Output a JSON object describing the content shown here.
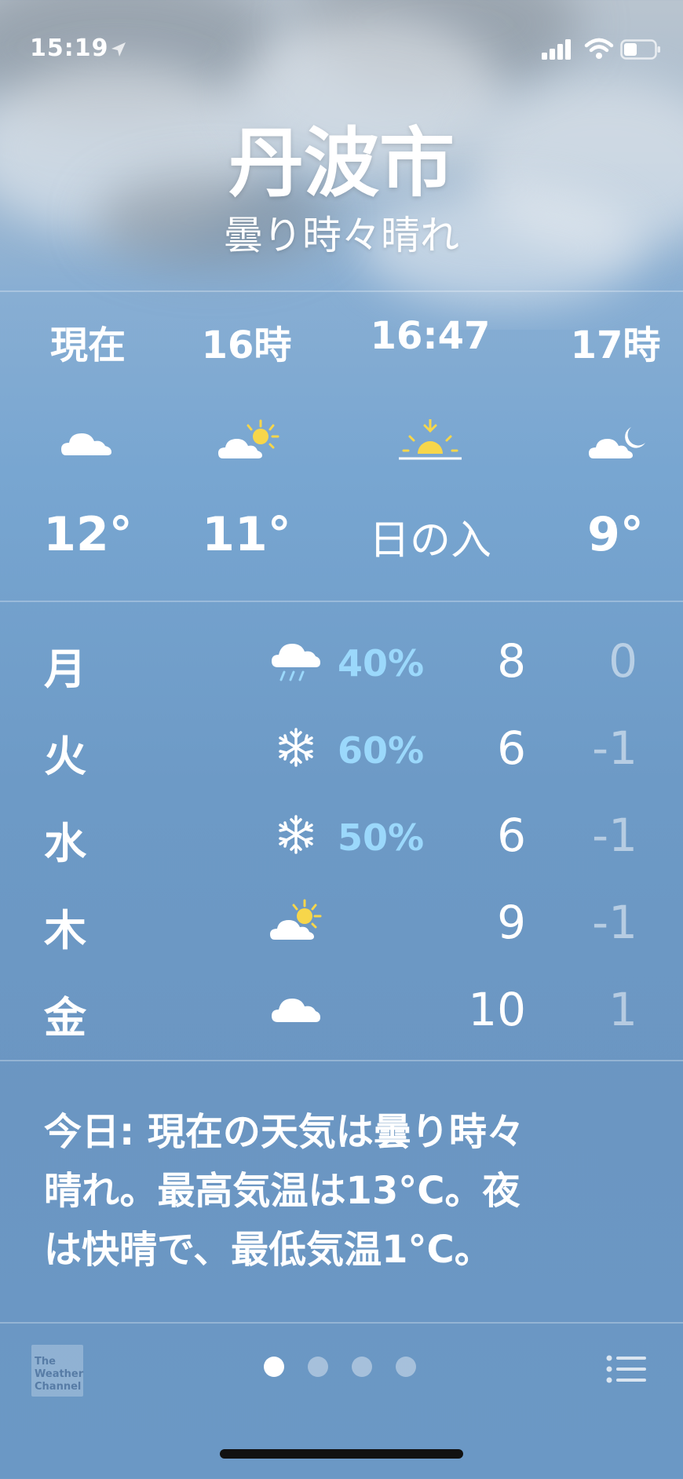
{
  "status_bar": {
    "time": "15:19",
    "location_icon": "location-arrow-icon",
    "signal_icon": "cellular-signal-icon",
    "wifi_icon": "wifi-icon",
    "battery_icon": "battery-icon"
  },
  "location": {
    "city": "丹波市",
    "condition": "曇り時々晴れ"
  },
  "hourly": [
    {
      "label": "現在",
      "icon": "cloud-icon",
      "value": "12°"
    },
    {
      "label": "16時",
      "icon": "partly-sunny-icon",
      "value": "11°"
    },
    {
      "label": "16:47",
      "icon": "sunset-icon",
      "value": "日の入"
    },
    {
      "label": "17時",
      "icon": "partly-cloudy-night-icon",
      "value": "9°"
    }
  ],
  "daily": [
    {
      "day": "月",
      "icon": "rain-cloud-icon",
      "precip": "40%",
      "high": "8",
      "low": "0"
    },
    {
      "day": "火",
      "icon": "snowflake-icon",
      "precip": "60%",
      "high": "6",
      "low": "-1"
    },
    {
      "day": "水",
      "icon": "snowflake-icon",
      "precip": "50%",
      "high": "6",
      "low": "-1"
    },
    {
      "day": "木",
      "icon": "partly-sunny-icon",
      "precip": "",
      "high": "9",
      "low": "-1"
    },
    {
      "day": "金",
      "icon": "cloud-icon",
      "precip": "",
      "high": "10",
      "low": "1"
    }
  ],
  "summary": {
    "line1": "今日: 現在の天気は曇り時々",
    "line2": "晴れ。最高気温は13°C。夜",
    "line3": "は快晴で、最低気温1°C。"
  },
  "footer": {
    "brand_line1": "The",
    "brand_line2": "Weather",
    "brand_line3": "Channel",
    "page_count": 4,
    "active_page": 1
  },
  "colors": {
    "precip": "#9bd8fb",
    "sun": "#f7d64a",
    "low_temp": "rgba(255,255,255,0.5)"
  }
}
